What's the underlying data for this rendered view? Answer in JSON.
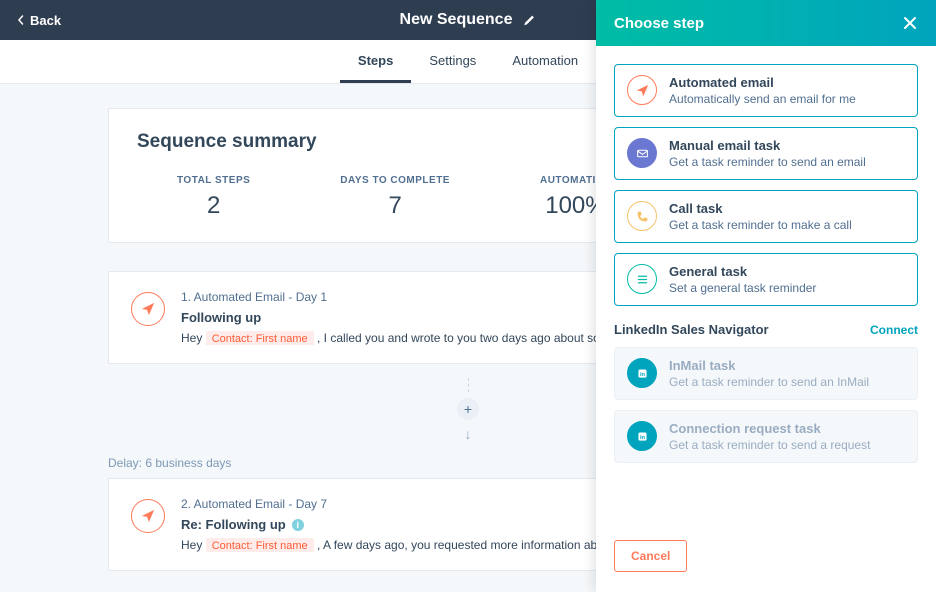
{
  "header": {
    "back_label": "Back",
    "title": "New Sequence"
  },
  "tabs": [
    {
      "label": "Steps",
      "active": true
    },
    {
      "label": "Settings",
      "active": false
    },
    {
      "label": "Automation",
      "active": false
    }
  ],
  "summary": {
    "title": "Sequence summary",
    "stats": [
      {
        "label": "TOTAL STEPS",
        "value": "2"
      },
      {
        "label": "DAYS TO COMPLETE",
        "value": "7"
      },
      {
        "label": "AUTOMATION",
        "value": "100%"
      }
    ]
  },
  "steps": [
    {
      "label": "1. Automated Email - Day 1",
      "title": "Following up",
      "preview_prefix": "Hey ",
      "token": "Contact: First name",
      "preview_suffix": " , I called you and wrote to you two days ago about some"
    },
    {
      "label": "2. Automated Email - Day 7",
      "title": "Re: Following up",
      "has_info": true,
      "preview_prefix": "Hey ",
      "token": "Contact: First name",
      "preview_suffix": " , A few days ago, you requested more information about"
    }
  ],
  "delay": {
    "label": "Delay:",
    "value": "6 business days"
  },
  "panel": {
    "title": "Choose step",
    "options": [
      {
        "title": "Automated email",
        "desc": "Automatically send an email for me",
        "icon": "send",
        "color": "#ff7a59"
      },
      {
        "title": "Manual email task",
        "desc": "Get a task reminder to send an email",
        "icon": "mail",
        "color": "#6a78d1"
      },
      {
        "title": "Call task",
        "desc": "Get a task reminder to make a call",
        "icon": "phone",
        "color": "#f5c26b"
      },
      {
        "title": "General task",
        "desc": "Set a general task reminder",
        "icon": "list",
        "color": "#00bda5"
      }
    ],
    "linkedin_label": "LinkedIn Sales Navigator",
    "connect_label": "Connect",
    "linkedin_options": [
      {
        "title": "InMail task",
        "desc": "Get a task reminder to send an InMail"
      },
      {
        "title": "Connection request task",
        "desc": "Get a task reminder to send a request"
      }
    ],
    "cancel_label": "Cancel"
  }
}
